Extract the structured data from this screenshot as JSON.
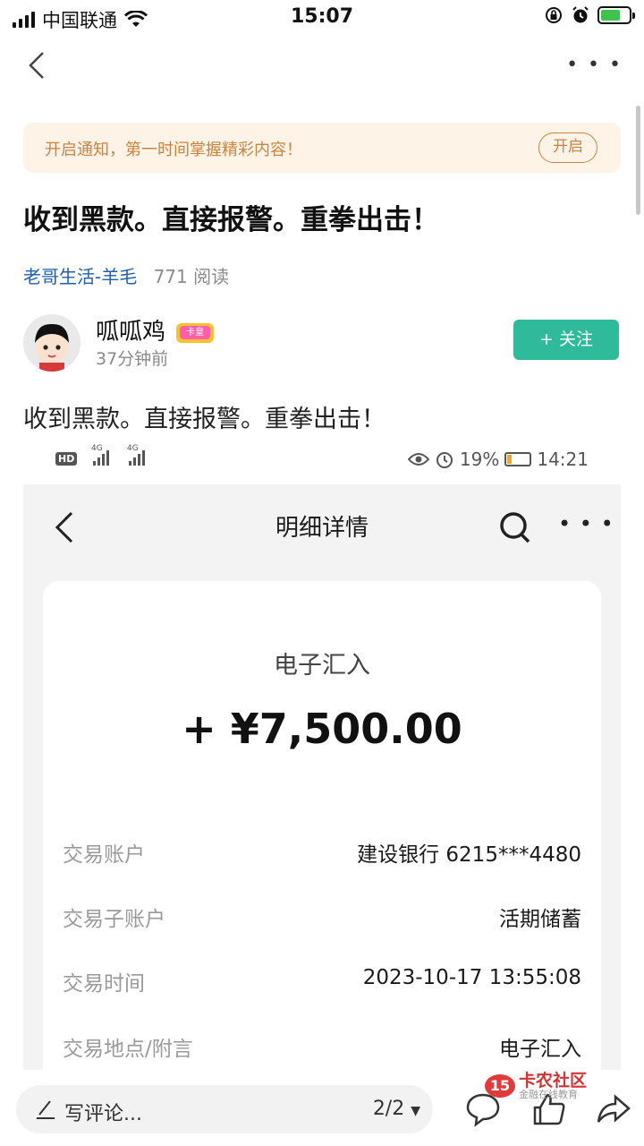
{
  "status_bar": {
    "carrier": "中国联通",
    "time": "15:07"
  },
  "notice": {
    "text": "开启通知，第一时间掌握精彩内容！",
    "button": "开启"
  },
  "post": {
    "title": "收到黑款。直接报警。重拳出击！",
    "board": "老哥生活-羊毛",
    "reads": "771 阅读",
    "author": "呱呱鸡",
    "badge": "卡皇",
    "time": "37分钟前",
    "follow": "+ 关注",
    "body": "收到黑款。直接报警。重拳出击！"
  },
  "inner_status": {
    "hd": "HD",
    "net1": "4G",
    "net2": "4G",
    "battery": "19%",
    "time": "14:21"
  },
  "screenshot": {
    "title": "明细详情",
    "type": "电子汇入",
    "amount": "+ ¥7,500.00",
    "rows": [
      {
        "label": "交易账户",
        "value": "建设银行 6215***4480"
      },
      {
        "label": "交易子账户",
        "value": "活期储蓄"
      },
      {
        "label": "交易时间",
        "value": "2023-10-17 13:55:08"
      },
      {
        "label": "交易地点/附言",
        "value": "电子汇入"
      }
    ]
  },
  "bottom": {
    "comment_placeholder": "写评论...",
    "pager": "2/2"
  },
  "watermark": {
    "badge": "15",
    "main": "卡农社区",
    "sub": "金融在线教育"
  }
}
